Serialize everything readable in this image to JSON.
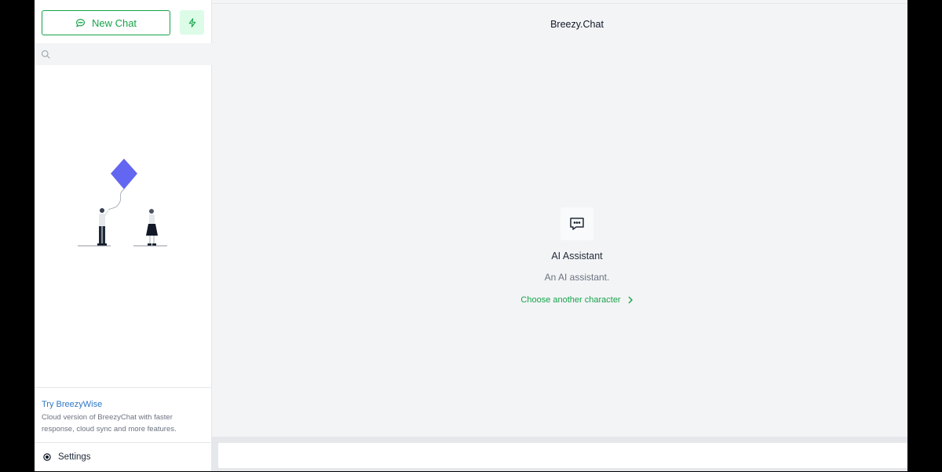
{
  "header": {
    "title": "Breezy.Chat"
  },
  "sidebar": {
    "new_chat_label": "New Chat",
    "search": {
      "placeholder": ""
    },
    "promo": {
      "title": "Try BreezyWise",
      "description": "Cloud version of BreezyChat with faster response, cloud sync and more features."
    },
    "settings_label": "Settings"
  },
  "character": {
    "name": "AI Assistant",
    "description": "An AI assistant.",
    "choose_label": "Choose another character"
  },
  "composer": {
    "placeholder": ""
  },
  "colors": {
    "accent": "#16a34a",
    "link": "#2f78c4",
    "kite": "#6366f1"
  },
  "icons": [
    "chat-bubble-icon",
    "lightning-icon",
    "search-icon",
    "settings-icon",
    "chevron-right-icon"
  ]
}
